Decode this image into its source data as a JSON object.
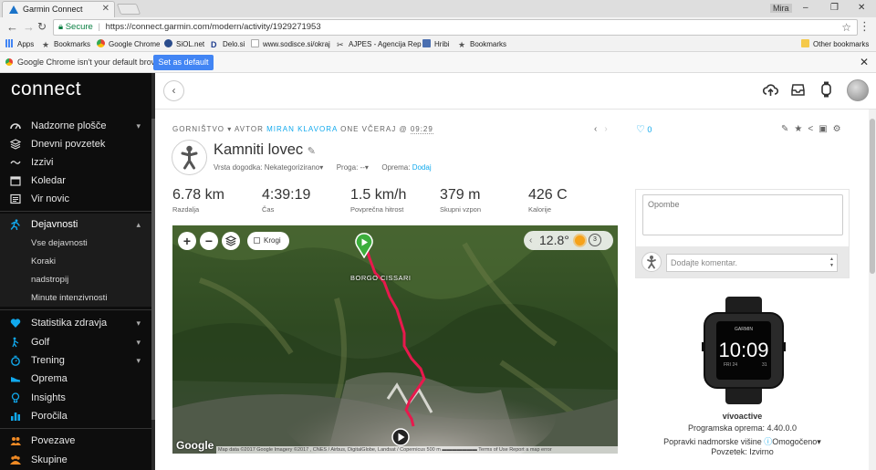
{
  "browser": {
    "tab_title": "Garmin Connect",
    "user_name": "Mira",
    "url_secure": "Secure",
    "url": "https://connect.garmin.com/modern/activity/1929271953",
    "bookmarks": [
      "Apps",
      "Bookmarks",
      "Google Chrome",
      "SiOL.net",
      "Delo.si",
      "www.sodisce.si/okraj",
      "AJPES - Agencija Rep",
      "Hribi",
      "Bookmarks",
      "Other bookmarks"
    ],
    "infobar_text": "Google Chrome isn't your default browser.",
    "set_default_label": "Set as default"
  },
  "sidebar": {
    "logo": "connect",
    "items": [
      {
        "label": "Nadzorne plošče",
        "icon": "dashboard-icon",
        "chevron": "⌄"
      },
      {
        "label": "Dnevni povzetek",
        "icon": "layers-icon"
      },
      {
        "label": "Izzivi",
        "icon": "challenge-icon"
      },
      {
        "label": "Koledar",
        "icon": "calendar-icon"
      },
      {
        "label": "Vir novic",
        "icon": "newsfeed-icon"
      },
      {
        "label": "Dejavnosti",
        "icon": "activity-runner-icon",
        "chevron": "⌃"
      },
      {
        "label": "Statistika zdravja",
        "icon": "heart-icon",
        "chevron": "⌄"
      },
      {
        "label": "Golf",
        "icon": "golf-icon",
        "chevron": "⌄"
      },
      {
        "label": "Trening",
        "icon": "stopwatch-icon",
        "chevron": "⌄"
      },
      {
        "label": "Oprema",
        "icon": "shoe-icon"
      },
      {
        "label": "Insights",
        "icon": "lightbulb-icon"
      },
      {
        "label": "Poročila",
        "icon": "bar-chart-icon"
      },
      {
        "label": "Povezave",
        "icon": "connections-icon"
      },
      {
        "label": "Skupine",
        "icon": "groups-icon"
      }
    ],
    "subitems": [
      "Vse dejavnosti",
      "Koraki",
      "nadstropij",
      "Minute intenzivnosti"
    ]
  },
  "activity": {
    "breadcrumb_type": "GORNIŠTVO",
    "breadcrumb_author_prefix": "AVTOR",
    "author": "MIRAN KLAVORA",
    "breadcrumb_when": "ONE VČERAJ @",
    "time": "09:29",
    "likes": "0",
    "title": "Kamniti lovec",
    "event_type_label": "Vrsta dogodka:",
    "event_type_value": "Nekategorizirano",
    "course_label": "Proga:",
    "course_value": "--",
    "gear_label": "Oprema:",
    "gear_value": "Dodaj"
  },
  "stats": [
    {
      "value": "6.78 km",
      "label": "Razdalja"
    },
    {
      "value": "4:39:19",
      "label": "Čas"
    },
    {
      "value": "1.5 km/h",
      "label": "Povprečna hitrost"
    },
    {
      "value": "379 m",
      "label": "Skupni vzpon"
    },
    {
      "value": "426 C",
      "label": "Kalorije"
    }
  ],
  "map": {
    "laps_label": "Krogi",
    "temperature": "12.8°",
    "weather_count": "3",
    "place_label": "BORGO CISSARI",
    "provider": "Google",
    "attribution": "Map data ©2017 Google Imagery ©2017 , CNES / Airbus, DigitalGlobe, Landsat / Copernicus   500 m ▬▬▬▬▬▬▬   Terms of Use   Report a map error"
  },
  "notes": {
    "placeholder": "Opombe",
    "comment_placeholder": "Dodajte komentar."
  },
  "device": {
    "watch_brand": "GARMIN",
    "watch_time": "10:09",
    "watch_left": "FRI 24",
    "watch_right": "31",
    "name": "vívoactive",
    "software_label": "Programska oprema:",
    "software_value": "4.40.0.0",
    "elevation_label": "Popravki nadmorske višine",
    "elevation_value": "Omogočeno",
    "source_label": "Povzetek:",
    "source_value": "Izvirno"
  },
  "colors": {
    "accent": "#11a9ed",
    "sidebar_bg": "#0d0d0d",
    "track": "#e8194d"
  }
}
